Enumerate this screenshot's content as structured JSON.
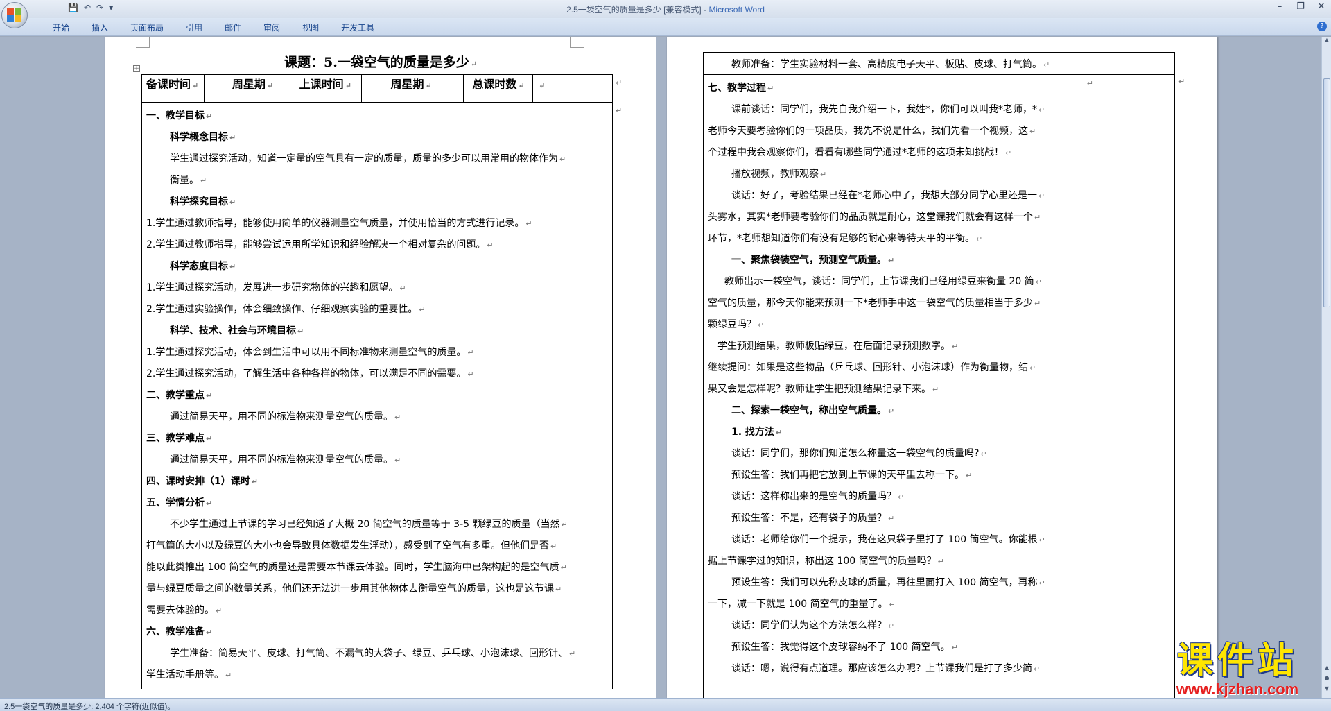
{
  "titlebar": {
    "doc_name": "2.5一袋空气的质量是多少 [兼容模式]",
    "separator": " - ",
    "app_name": "Microsoft Word"
  },
  "ribbon": {
    "tabs": [
      "开始",
      "插入",
      "页面布局",
      "引用",
      "邮件",
      "审阅",
      "视图",
      "开发工具"
    ]
  },
  "left_page": {
    "title": "课题：5.一袋空气的质量是多少",
    "header_cells": [
      "备课时间",
      "周星期",
      "上课时间",
      "周星期",
      "总课时数",
      ""
    ],
    "lines": [
      {
        "text": "一、教学目标",
        "style": "b"
      },
      {
        "text": "科学概念目标",
        "style": "b indent"
      },
      {
        "text": "学生通过探究活动，知道一定量的空气具有一定的质量，质量的多少可以用常用的物体作为",
        "style": "indent"
      },
      {
        "text": "衡量。",
        "style": "indent"
      },
      {
        "text": "科学探究目标",
        "style": "b indent"
      },
      {
        "text": "1.学生通过教师指导，能够使用简单的仪器测量空气质量，并使用恰当的方式进行记录。",
        "style": ""
      },
      {
        "text": "2.学生通过教师指导，能够尝试运用所学知识和经验解决一个相对复杂的问题。",
        "style": ""
      },
      {
        "text": "科学态度目标",
        "style": "b indent"
      },
      {
        "text": "1.学生通过探究活动，发展进一步研究物体的兴趣和愿望。",
        "style": ""
      },
      {
        "text": "2.学生通过实验操作，体会细致操作、仔细观察实验的重要性。",
        "style": ""
      },
      {
        "text": "科学、技术、社会与环境目标",
        "style": "b indent"
      },
      {
        "text": "1.学生通过探究活动，体会到生活中可以用不同标准物来测量空气的质量。",
        "style": ""
      },
      {
        "text": "2.学生通过探究活动，了解生活中各种各样的物体，可以满足不同的需要。",
        "style": ""
      },
      {
        "text": "二、教学重点",
        "style": "b"
      },
      {
        "text": "通过简易天平，用不同的标准物来测量空气的质量。",
        "style": "indent"
      },
      {
        "text": "三、教学难点",
        "style": "b"
      },
      {
        "text": "通过简易天平，用不同的标准物来测量空气的质量。",
        "style": "indent"
      },
      {
        "text": "四、课时安排（1）课时",
        "style": "b"
      },
      {
        "text": "五、学情分析",
        "style": "b"
      },
      {
        "text": "不少学生通过上节课的学习已经知道了大概 20 简空气的质量等于 3-5 颗绿豆的质量（当然",
        "style": "indent"
      },
      {
        "text": "打气筒的大小以及绿豆的大小也会导致具体数据发生浮动），感受到了空气有多重。但他们是否",
        "style": ""
      },
      {
        "text": "能以此类推出 100 简空气的质量还是需要本节课去体验。同时，学生脑海中已架构起的是空气质",
        "style": ""
      },
      {
        "text": "量与绿豆质量之间的数量关系，他们还无法进一步用其他物体去衡量空气的质量，这也是这节课",
        "style": ""
      },
      {
        "text": "需要去体验的。",
        "style": ""
      },
      {
        "text": "六、教学准备",
        "style": "b"
      },
      {
        "text": "学生准备：简易天平、皮球、打气筒、不漏气的大袋子、绿豆、乒乓球、小泡沫球、回形针、",
        "style": "indent"
      },
      {
        "text": "学生活动手册等。",
        "style": ""
      }
    ]
  },
  "right_page": {
    "first_row": "教师准备：学生实验材料一套、高精度电子天平、板贴、皮球、打气筒。",
    "lines": [
      {
        "text": "七、教学过程",
        "style": "b"
      },
      {
        "text": "课前谈话：同学们，我先自我介绍一下，我姓*，你们可以叫我*老师，*",
        "style": "indent"
      },
      {
        "text": "老师今天要考验你们的一项品质，我先不说是什么，我们先看一个视频，这",
        "style": ""
      },
      {
        "text": "个过程中我会观察你们，看看有哪些同学通过*老师的这项未知挑战！",
        "style": ""
      },
      {
        "text": "播放视频，教师观察",
        "style": "indent"
      },
      {
        "text": "谈话：好了，考验结果已经在*老师心中了，我想大部分同学心里还是一",
        "style": "indent"
      },
      {
        "text": "头雾水，其实*老师要考验你们的品质就是耐心，这堂课我们就会有这样一个",
        "style": ""
      },
      {
        "text": "环节，*老师想知道你们有没有足够的耐心来等待天平的平衡。",
        "style": ""
      },
      {
        "text": "一、聚焦袋装空气，预测空气质量。",
        "style": "b indent"
      },
      {
        "text": "教师出示一袋空气，谈话：同学们，上节课我们已经用绿豆来衡量 20 简",
        "style": "indent-s"
      },
      {
        "text": "空气的质量，那今天你能来预测一下*老师手中这一袋空气的质量相当于多少",
        "style": ""
      },
      {
        "text": "颗绿豆吗？",
        "style": ""
      },
      {
        "text": "学生预测结果，教师板贴绿豆，在后面记录预测数字。",
        "style": "indent-xs"
      },
      {
        "text": "继续提问：如果是这些物品（乒乓球、回形针、小泡沫球）作为衡量物，结",
        "style": ""
      },
      {
        "text": "果又会是怎样呢？教师让学生把预测结果记录下来。",
        "style": ""
      },
      {
        "text": "二、探索一袋空气，称出空气质量。",
        "style": "b indent"
      },
      {
        "text": "1. 找方法",
        "style": "b indent"
      },
      {
        "text": "谈话：同学们，那你们知道怎么称量这一袋空气的质量吗?",
        "style": "indent"
      },
      {
        "text": "预设生答：我们再把它放到上节课的天平里去称一下。",
        "style": "indent"
      },
      {
        "text": "谈话：这样称出来的是空气的质量吗？",
        "style": "indent"
      },
      {
        "text": "预设生答：不是，还有袋子的质量？",
        "style": "indent"
      },
      {
        "text": "谈话：老师给你们一个提示，我在这只袋子里打了 100 简空气。你能根",
        "style": "indent"
      },
      {
        "text": "据上节课学过的知识，称出这 100 简空气的质量吗？",
        "style": ""
      },
      {
        "text": "预设生答：我们可以先称皮球的质量，再往里面打入 100 简空气，再称",
        "style": "indent"
      },
      {
        "text": "一下，减一下就是 100 简空气的重量了。",
        "style": ""
      },
      {
        "text": "谈话：同学们认为这个方法怎么样？",
        "style": "indent"
      },
      {
        "text": "预设生答：我觉得这个皮球容纳不了 100 简空气。",
        "style": "indent"
      },
      {
        "text": "谈话：嗯，说得有点道理。那应该怎么办呢？上节课我们是打了多少简",
        "style": "indent"
      }
    ]
  },
  "statusbar": {
    "text": "2.5一袋空气的质量是多少: 2,404 个字符(近似值)。"
  },
  "watermark": {
    "main": "课件站",
    "url": "www.kjzhan.com"
  },
  "colors": {
    "workspace": "#a6b3c6",
    "ribbon_text": "#15428b",
    "watermark_yellow": "#ffe600",
    "watermark_red": "#e62020"
  }
}
